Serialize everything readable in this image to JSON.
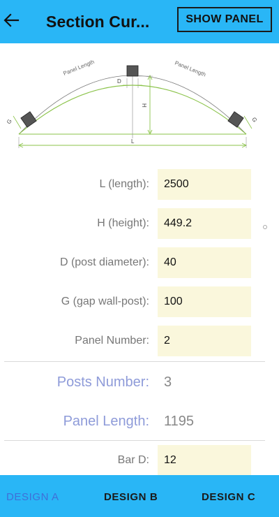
{
  "header": {
    "title": "Section Cur...",
    "show_panel_label": "SHOW PANEL"
  },
  "diagram": {
    "panel_length_left": "Panel Length",
    "panel_length_right": "Panel Length",
    "d_label": "D",
    "h_label": "H",
    "g_left": "G",
    "g_right": "G",
    "l_label": "L"
  },
  "form": {
    "length": {
      "label": "L (length):",
      "value": "2500"
    },
    "height": {
      "label": "H (height):",
      "value": "449.2"
    },
    "post_diameter": {
      "label": "D (post diameter):",
      "value": "40"
    },
    "gap": {
      "label": "G (gap wall-post):",
      "value": "100"
    },
    "panel_number": {
      "label": "Panel Number:",
      "value": "2"
    },
    "bar_d": {
      "label": "Bar D:",
      "value": "12"
    }
  },
  "results": {
    "posts_number": {
      "label": "Posts Number:",
      "value": "3"
    },
    "panel_length": {
      "label": "Panel Length:",
      "value": "1195"
    }
  },
  "tabs": [
    {
      "label": "DESIGN A",
      "active": true
    },
    {
      "label": "DESIGN B",
      "active": false
    },
    {
      "label": "DESIGN C",
      "active": false
    }
  ],
  "colors": {
    "accent": "#29b6f6",
    "input_bg": "#faf7dc",
    "result_label": "#8e9bd9",
    "active_tab": "#3f6fd8"
  }
}
